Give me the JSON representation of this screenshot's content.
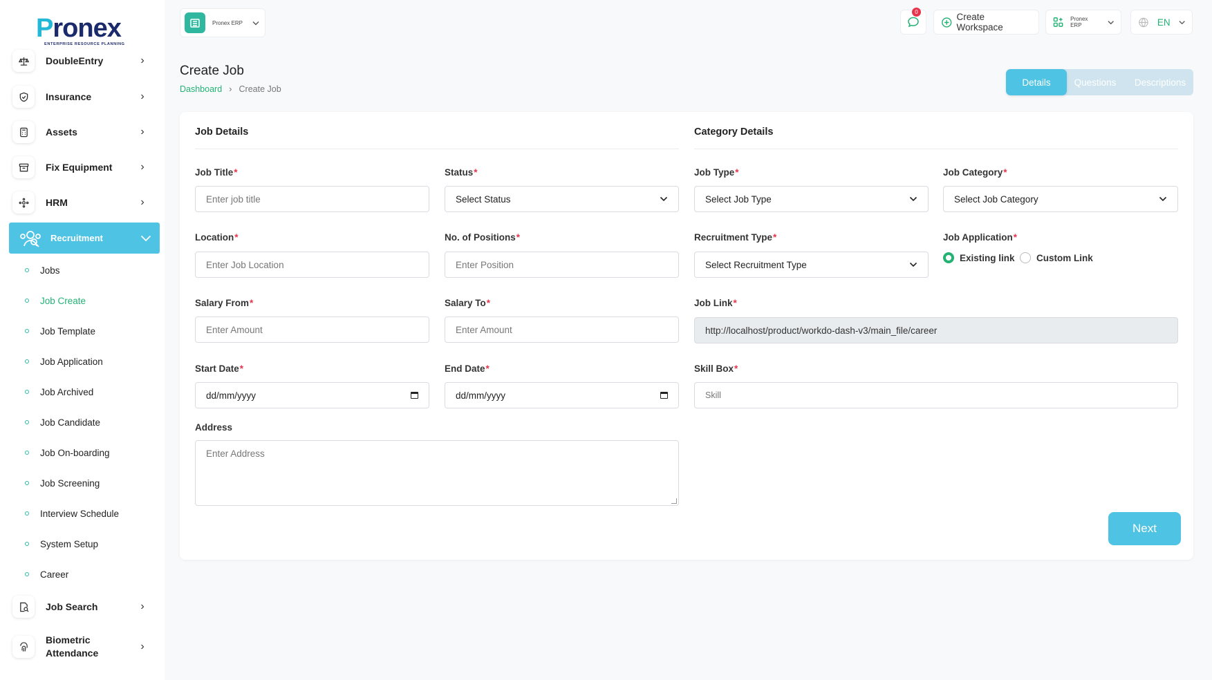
{
  "brand": {
    "logo_word_part1": "P",
    "logo_word_part2": "ronex",
    "logo_tagline": "ENTERPRISE RESOURCE PLANNING"
  },
  "sidebar": {
    "items_top": [
      {
        "label": "DoubleEntry",
        "icon": "scale-icon"
      },
      {
        "label": "Insurance",
        "icon": "shield-icon"
      },
      {
        "label": "Assets",
        "icon": "calculator-icon"
      },
      {
        "label": "Fix Equipment",
        "icon": "archive-icon"
      },
      {
        "label": "HRM",
        "icon": "network-icon"
      }
    ],
    "active": {
      "label": "Recruitment",
      "icon": "recruitment-icon"
    },
    "sub_items": [
      {
        "label": "Jobs",
        "active": false
      },
      {
        "label": "Job Create",
        "active": true
      },
      {
        "label": "Job Template",
        "active": false
      },
      {
        "label": "Job Application",
        "active": false
      },
      {
        "label": "Job Archived",
        "active": false
      },
      {
        "label": "Job Candidate",
        "active": false
      },
      {
        "label": "Job On-boarding",
        "active": false
      },
      {
        "label": "Job Screening",
        "active": false
      },
      {
        "label": "Interview Schedule",
        "active": false
      },
      {
        "label": "System Setup",
        "active": false
      },
      {
        "label": "Career",
        "active": false
      }
    ],
    "items_bottom": [
      {
        "label": "Job Search",
        "icon": "document-search-icon"
      },
      {
        "label": "Biometric Attendance",
        "icon": "fingerprint-icon"
      }
    ]
  },
  "topbar": {
    "workspace_name": "Pronex ERP",
    "notification_count": "0",
    "create_workspace_label": "Create Workspace",
    "erp_selector_label": "Pronex ERP",
    "language": "EN"
  },
  "header": {
    "title": "Create Job",
    "breadcrumb_home": "Dashboard",
    "breadcrumb_current": "Create Job"
  },
  "tabs": [
    {
      "label": "Details",
      "active": true
    },
    {
      "label": "Questions",
      "active": false
    },
    {
      "label": "Descriptions",
      "active": false
    }
  ],
  "form": {
    "job_details_title": "Job Details",
    "category_details_title": "Category Details",
    "job_title": {
      "label": "Job Title",
      "placeholder": "Enter job title"
    },
    "status": {
      "label": "Status",
      "value": "Select Status"
    },
    "job_type": {
      "label": "Job Type",
      "value": "Select Job Type"
    },
    "job_category": {
      "label": "Job Category",
      "value": "Select Job Category"
    },
    "location": {
      "label": "Location",
      "placeholder": "Enter Job Location"
    },
    "positions": {
      "label": "No. of Positions",
      "placeholder": "Enter Position"
    },
    "recruitment_type": {
      "label": "Recruitment Type",
      "value": "Select Recruitment Type"
    },
    "job_application": {
      "label": "Job Application",
      "option_existing": "Existing link",
      "option_custom": "Custom Link",
      "selected": "existing"
    },
    "salary_from": {
      "label": "Salary From",
      "placeholder": "Enter Amount"
    },
    "salary_to": {
      "label": "Salary To",
      "placeholder": "Enter Amount"
    },
    "job_link": {
      "label": "Job Link",
      "value": "http://localhost/product/workdo-dash-v3/main_file/career"
    },
    "start_date": {
      "label": "Start Date",
      "value": "dd/mm/yyyy"
    },
    "end_date": {
      "label": "End Date",
      "value": "dd/mm/yyyy"
    },
    "skill_box": {
      "label": "Skill Box",
      "placeholder": "Skill"
    },
    "address": {
      "label": "Address",
      "placeholder": "Enter Address"
    },
    "required_mark": "*",
    "next_label": "Next"
  },
  "colors": {
    "accent": "#4ec3e3",
    "green": "#23b274",
    "required": "#e8334a"
  }
}
